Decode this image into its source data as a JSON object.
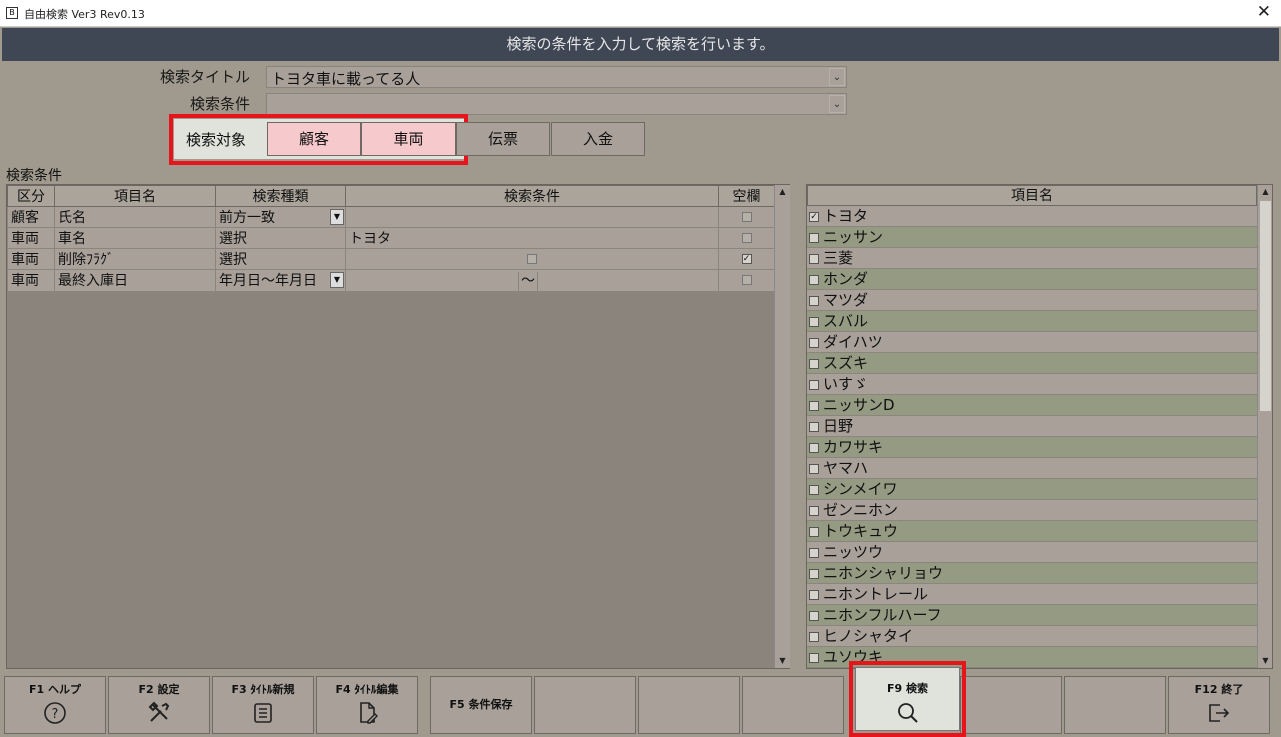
{
  "window": {
    "title": "自由検索 Ver3 Rev0.13",
    "close": "✕"
  },
  "banner": "検索の条件を入力して検索を行います。",
  "form": {
    "title_label": "検索タイトル",
    "title_value": "トヨタ車に載ってる人",
    "cond_label": "検索条件",
    "cond_value": "",
    "target_label": "検索対象",
    "targets": [
      {
        "label": "顧客",
        "selected": true
      },
      {
        "label": "車両",
        "selected": true
      },
      {
        "label": "伝票",
        "selected": false
      },
      {
        "label": "入金",
        "selected": false
      }
    ]
  },
  "conditions": {
    "section_label": "検索条件",
    "headers": [
      "区分",
      "項目名",
      "検索種類",
      "検索条件",
      "空欄"
    ],
    "rows": [
      {
        "kubun": "顧客",
        "item": "氏名",
        "kind": "前方一致",
        "kind_dropdown": true,
        "cond": "",
        "blank": false
      },
      {
        "kubun": "車両",
        "item": "車名",
        "kind": "選択",
        "kind_dropdown": false,
        "cond": "トヨタ",
        "blank": false
      },
      {
        "kubun": "車両",
        "item": "削除ﾌﾗｸﾞ",
        "kind": "選択",
        "kind_dropdown": false,
        "cond": "",
        "cond_checkbox": true,
        "blank": true
      },
      {
        "kubun": "車両",
        "item": "最終入庫日",
        "kind": "年月日～年月日",
        "kind_dropdown": true,
        "cond": "",
        "cond_range_sep": "～",
        "blank": false
      }
    ]
  },
  "item_list": {
    "header": "項目名",
    "items": [
      {
        "label": "トヨタ",
        "checked": true
      },
      {
        "label": "ニッサン",
        "checked": false
      },
      {
        "label": "三菱",
        "checked": false
      },
      {
        "label": "ホンダ",
        "checked": false
      },
      {
        "label": "マツダ",
        "checked": false
      },
      {
        "label": "スバル",
        "checked": false
      },
      {
        "label": "ダイハツ",
        "checked": false
      },
      {
        "label": "スズキ",
        "checked": false
      },
      {
        "label": "いすゞ",
        "checked": false
      },
      {
        "label": "ニッサンD",
        "checked": false
      },
      {
        "label": "日野",
        "checked": false
      },
      {
        "label": "カワサキ",
        "checked": false
      },
      {
        "label": "ヤマハ",
        "checked": false
      },
      {
        "label": "シンメイワ",
        "checked": false
      },
      {
        "label": "ゼンニホン",
        "checked": false
      },
      {
        "label": "トウキュウ",
        "checked": false
      },
      {
        "label": "ニッツウ",
        "checked": false
      },
      {
        "label": "ニホンシャリョウ",
        "checked": false
      },
      {
        "label": "ニホントレール",
        "checked": false
      },
      {
        "label": "ニホンフルハーフ",
        "checked": false
      },
      {
        "label": "ヒノシャタイ",
        "checked": false
      },
      {
        "label": "ユソウキ",
        "checked": false
      }
    ]
  },
  "fkeys": {
    "f1": {
      "label": "F1 ヘルプ",
      "icon": "help-circle-icon"
    },
    "f2": {
      "label": "F2 設定",
      "icon": "tools-icon"
    },
    "f3": {
      "label": "F3 ﾀｲﾄﾙ新規",
      "icon": "document-list-icon"
    },
    "f4": {
      "label": "F4 ﾀｲﾄﾙ編集",
      "icon": "document-edit-icon"
    },
    "f5": {
      "label": "F5 条件保存"
    },
    "f9": {
      "label": "F9 検索",
      "icon": "search-icon"
    },
    "f12": {
      "label": "F12 終了",
      "icon": "exit-icon"
    }
  },
  "colors": {
    "highlight_border": "#e8141b",
    "selected_target": "#f6c9cc",
    "banner_bg": "#3f4654"
  }
}
